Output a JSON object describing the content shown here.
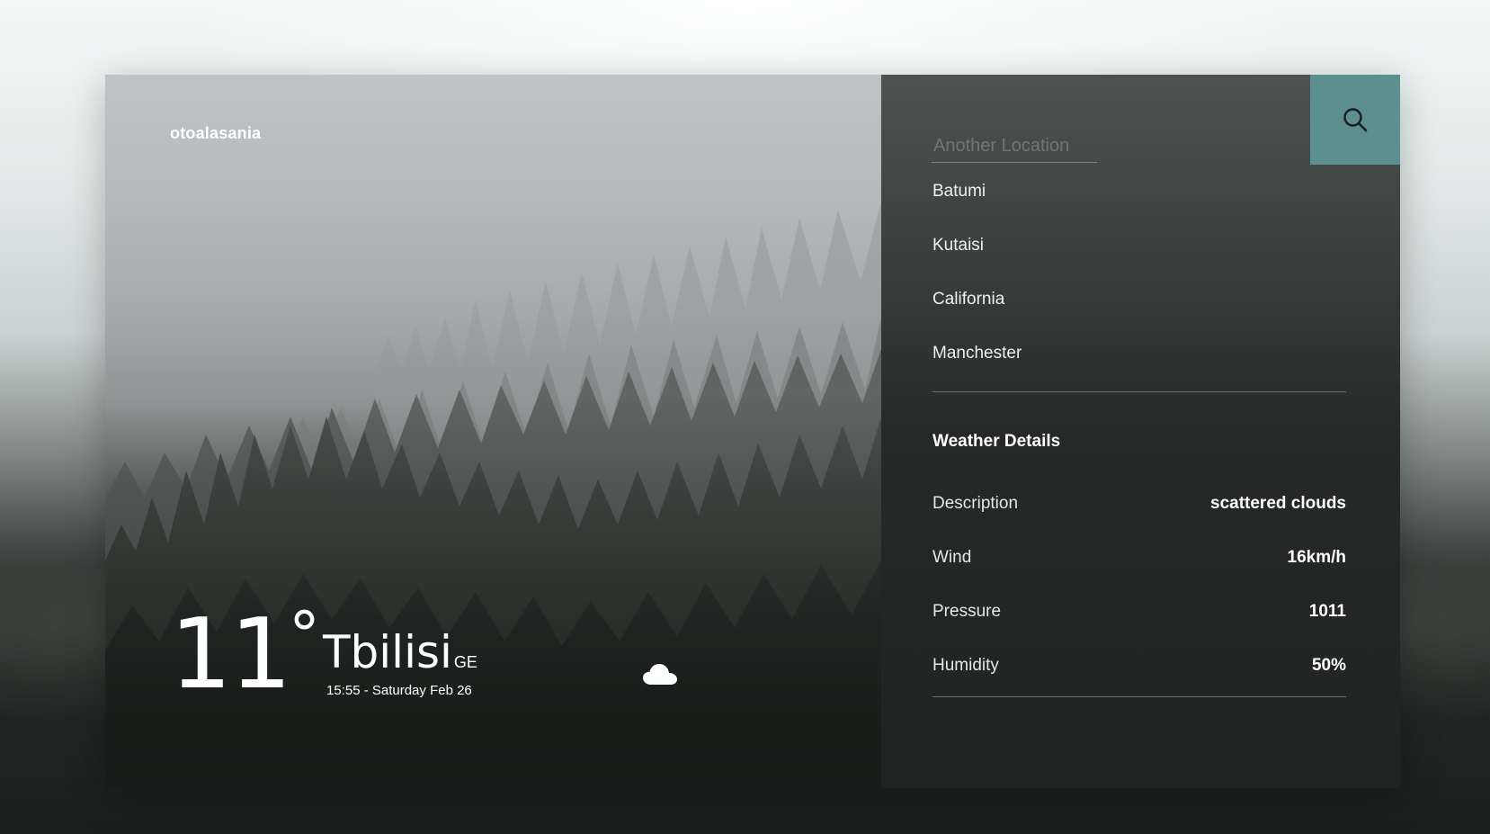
{
  "brand": {
    "name": "otoalasania"
  },
  "current": {
    "temperature": "11",
    "degree_symbol": "°",
    "city": "Tbilisi",
    "country": "GE",
    "datetime": "15:55 - Saturday Feb 26",
    "icon": "cloud-icon"
  },
  "search": {
    "placeholder": "Another Location",
    "value": "",
    "button_icon": "search-icon",
    "button_color": "#5d8e90"
  },
  "locations": [
    "Batumi",
    "Kutaisi",
    "California",
    "Manchester"
  ],
  "details": {
    "title": "Weather Details",
    "rows": [
      {
        "label": "Description",
        "value": "scattered clouds"
      },
      {
        "label": "Wind",
        "value": "16km/h"
      },
      {
        "label": "Pressure",
        "value": "1011"
      },
      {
        "label": "Humidity",
        "value": "50%"
      }
    ]
  }
}
